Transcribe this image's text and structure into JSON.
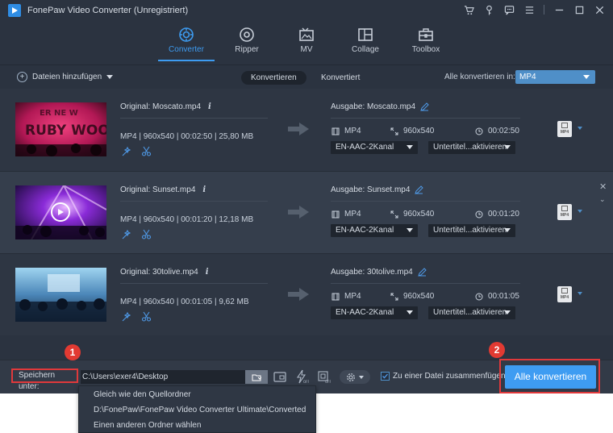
{
  "app": {
    "title": "FonePaw Video Converter (Unregistriert)"
  },
  "nav": {
    "tabs": [
      {
        "label": "Converter",
        "icon": "converter-icon",
        "active": true
      },
      {
        "label": "Ripper",
        "icon": "disc-icon",
        "active": false
      },
      {
        "label": "MV",
        "icon": "mv-icon",
        "active": false
      },
      {
        "label": "Collage",
        "icon": "collage-icon",
        "active": false
      },
      {
        "label": "Toolbox",
        "icon": "toolbox-icon",
        "active": false
      }
    ]
  },
  "toolbar": {
    "add_files": "Dateien hinzufügen",
    "tab_converting": "Konvertieren",
    "tab_converted": "Konvertiert",
    "convert_all_to": "Alle konvertieren in:",
    "format": "MP4"
  },
  "files": [
    {
      "original": "Original: Moscato.mp4",
      "meta": "MP4 | 960x540 | 00:02:50 | 25,80 MB",
      "output": "Ausgabe: Moscato.mp4",
      "out_format": "MP4",
      "out_resolution": "960x540",
      "out_duration": "00:02:50",
      "audio": "EN-AAC-2Kanal",
      "subtitle": "Untertitel...aktivieren",
      "format_badge": "MP4"
    },
    {
      "original": "Original: Sunset.mp4",
      "meta": "MP4 | 960x540 | 00:01:20 | 12,18 MB",
      "output": "Ausgabe: Sunset.mp4",
      "out_format": "MP4",
      "out_resolution": "960x540",
      "out_duration": "00:01:20",
      "audio": "EN-AAC-2Kanal",
      "subtitle": "Untertitel...aktivieren",
      "format_badge": "MP4"
    },
    {
      "original": "Original: 30tolive.mp4",
      "meta": "MP4 | 960x540 | 00:01:05 | 9,62 MB",
      "output": "Ausgabe: 30tolive.mp4",
      "out_format": "MP4",
      "out_resolution": "960x540",
      "out_duration": "00:01:05",
      "audio": "EN-AAC-2Kanal",
      "subtitle": "Untertitel...aktivieren",
      "format_badge": "MP4"
    }
  ],
  "bottom": {
    "save_to_label": "Speichern unter:",
    "save_path": "C:\\Users\\exer4\\Desktop",
    "merge_label": "Zu einer Datei zusammenfügen",
    "merge_checked": true,
    "convert_all": "Alle konvertieren",
    "step1": "1",
    "step2": "2"
  },
  "save_menu": {
    "items": [
      "Gleich wie den Quellordner",
      "D:\\FonePaw\\FonePaw Video Converter Ultimate\\Converted",
      "Einen anderen Ordner wählen"
    ]
  },
  "colors": {
    "accent": "#3d9bf0",
    "highlight_red": "#e0393b",
    "background": "#2b3340"
  }
}
